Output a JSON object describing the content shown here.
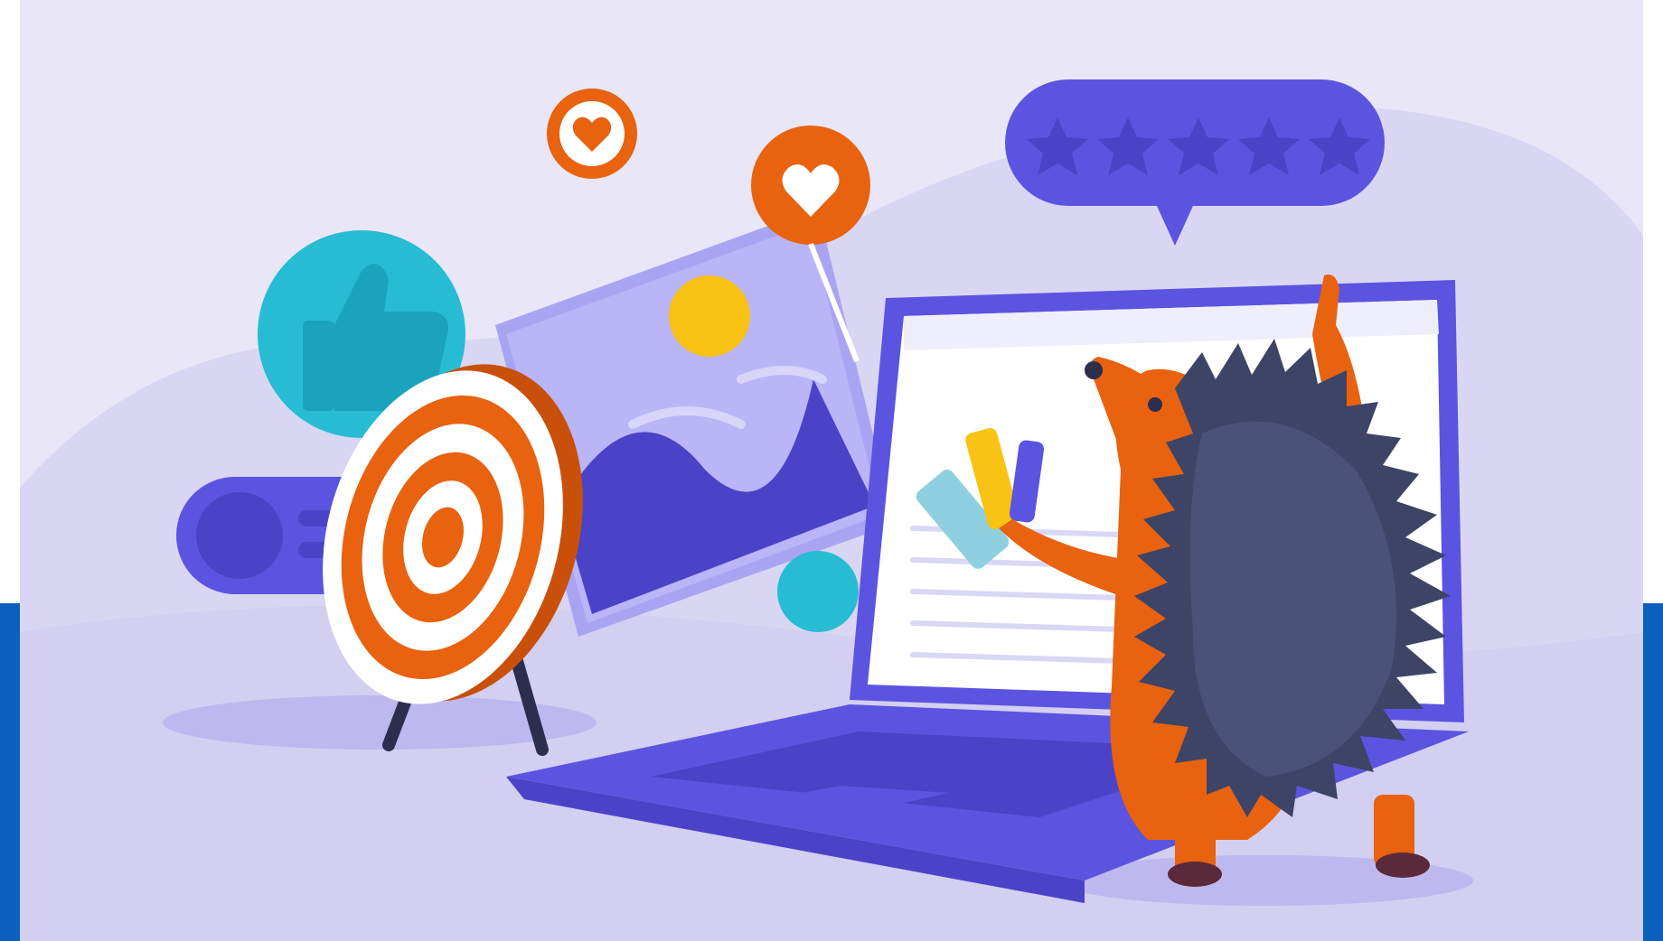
{
  "illustration": {
    "subject": "hedgehog-with-laptop",
    "icons": [
      "heart-icon",
      "heart-icon",
      "thumbs-up-icon",
      "star-icon",
      "target-icon",
      "image-icon",
      "color-swatch-icon"
    ],
    "rating": {
      "filled_stars": 0,
      "total_stars": 5
    },
    "colors": {
      "background": "#e8e6f7",
      "hill": "#d6d3f3",
      "purple": "#5b54e0",
      "purple_dark": "#4a43c8",
      "orange": "#e8620f",
      "teal": "#27bcd4",
      "yellow": "#f9c316",
      "navy_spikes": "#3d4466",
      "frame_blue": "#0a5fbf",
      "white": "#ffffff"
    }
  }
}
